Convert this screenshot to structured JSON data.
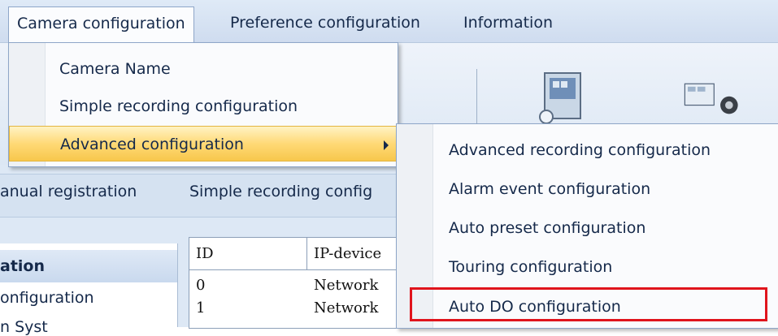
{
  "menubar": {
    "items": [
      {
        "label": "Camera configuration"
      },
      {
        "label": "Preference configuration"
      },
      {
        "label": "Information"
      }
    ]
  },
  "camera_menu": {
    "items": [
      {
        "label": "Camera Name"
      },
      {
        "label": "Simple recording configuration"
      },
      {
        "label": "Advanced configuration"
      }
    ]
  },
  "advanced_submenu": {
    "items": [
      {
        "label": "Advanced recording configuration"
      },
      {
        "label": "Alarm event configuration"
      },
      {
        "label": "Auto preset configuration"
      },
      {
        "label": "Touring configuration"
      },
      {
        "label": "Auto DO configuration"
      }
    ],
    "highlight_color": "#e0141c"
  },
  "toolbar": {
    "manual_registration": "anual registration",
    "simple_recording": "Simple recording config"
  },
  "left_pane": {
    "header": "ation",
    "row1": "onfiguration",
    "row2": "n Syst"
  },
  "device_table": {
    "headers": [
      "ID",
      "IP-device"
    ],
    "rows": [
      [
        "0",
        "Network"
      ],
      [
        "1",
        "Network"
      ]
    ]
  },
  "icons": [
    "camera-device-icon",
    "video-film-icon"
  ]
}
